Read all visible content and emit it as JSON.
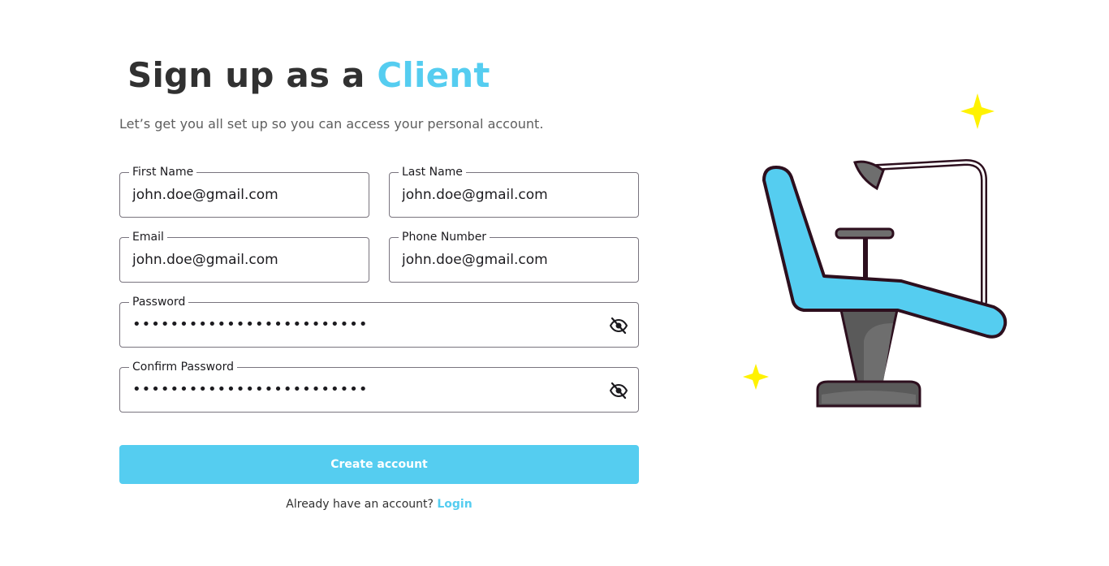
{
  "heading": {
    "prefix": "Sign up as a ",
    "accent": "Client"
  },
  "subtitle": "Let’s get you all set up so you can access your personal account.",
  "fields": {
    "first_name": {
      "label": "First Name",
      "value": "john.doe@gmail.com"
    },
    "last_name": {
      "label": "Last Name",
      "value": "john.doe@gmail.com"
    },
    "email": {
      "label": "Email",
      "value": "john.doe@gmail.com"
    },
    "phone": {
      "label": "Phone Number",
      "value": "john.doe@gmail.com"
    },
    "password": {
      "label": "Password",
      "value": "•••••••••••••••••••••••••"
    },
    "confirm_password": {
      "label": "Confirm Password",
      "value": "•••••••••••••••••••••••••"
    }
  },
  "create_button": "Create account",
  "login_prompt": {
    "text": "Already have an account? ",
    "link": "Login"
  },
  "icons": {
    "password_toggle": "eye-off-icon",
    "illustration": "dental-chair-illustration"
  },
  "colors": {
    "accent": "#55CDF0",
    "sparkle": "#FFF200",
    "chair": "#55CDF0",
    "outline": "#2d0f1e"
  }
}
